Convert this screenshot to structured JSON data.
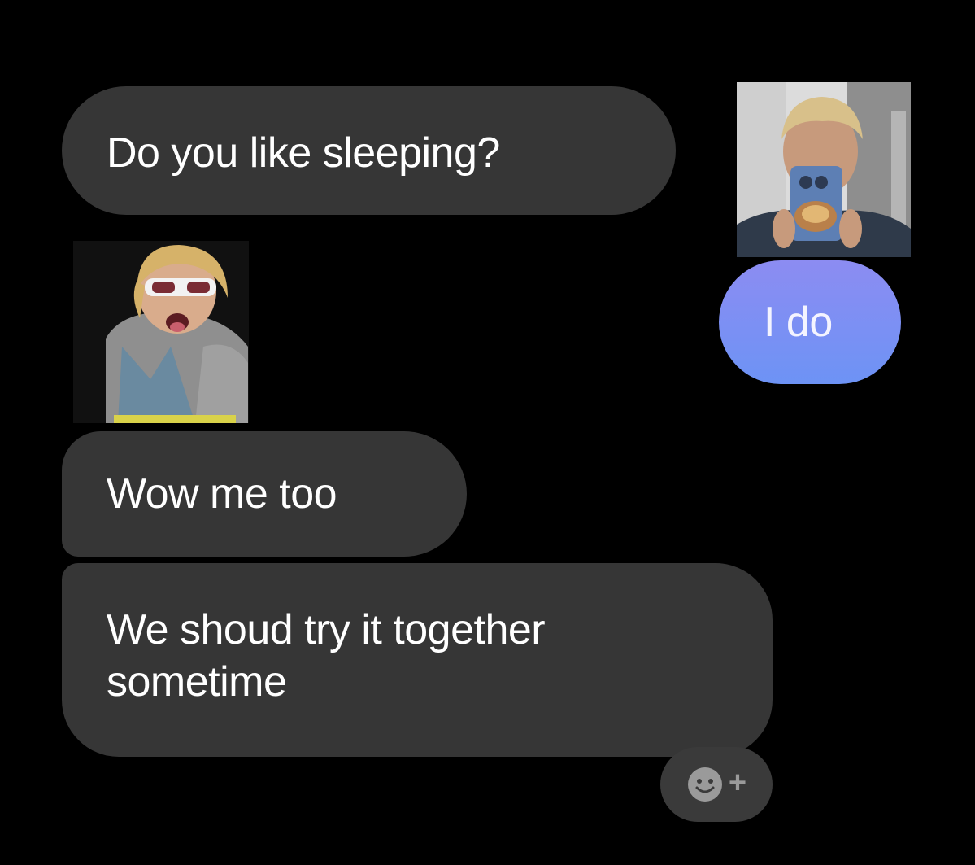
{
  "messages": [
    {
      "sender": "other",
      "text": "Do you like sleeping?"
    },
    {
      "sender": "me",
      "text": "I do"
    },
    {
      "sender": "other",
      "text": "Wow me too"
    },
    {
      "sender": "other",
      "text": "We shoud try it together\nsometime"
    }
  ],
  "reaction": {
    "icon": "smiley-icon",
    "plus": "+"
  },
  "colors": {
    "background": "#000000",
    "incoming_bubble": "#363636",
    "outgoing_bubble_top": "#8c8cf2",
    "outgoing_bubble_bottom": "#6d93f5",
    "text": "#ffffff"
  }
}
